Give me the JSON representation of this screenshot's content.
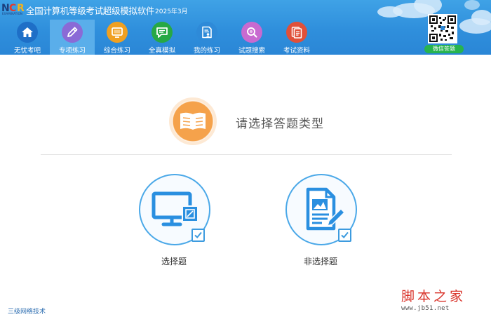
{
  "header": {
    "logo_text": "NCR",
    "logo_subtext": "EXAMINATION",
    "title": "全国计算机等级考试超级模拟软件",
    "year": "2025年3月"
  },
  "nav": {
    "items": [
      {
        "label": "无忧考吧",
        "icon": "home-icon",
        "color": "#1e6fc7",
        "active": false
      },
      {
        "label": "专项练习",
        "icon": "pencil-icon",
        "color": "#8a6ad6",
        "active": true
      },
      {
        "label": "综合练习",
        "icon": "monitor-icon",
        "color": "#f0a020",
        "active": false
      },
      {
        "label": "全真模拟",
        "icon": "chat-icon",
        "color": "#27a845",
        "active": false
      },
      {
        "label": "我的练习",
        "icon": "document-user-icon",
        "color": "#2e8ad8",
        "active": false
      },
      {
        "label": "试题搜索",
        "icon": "search-icon",
        "color": "#c86ad0",
        "active": false
      },
      {
        "label": "考试资料",
        "icon": "documents-icon",
        "color": "#e0503a",
        "active": false
      }
    ]
  },
  "qr": {
    "label": "微信答题"
  },
  "main": {
    "prompt": "请选择答题类型",
    "choices": [
      {
        "label": "选择题",
        "icon": "monitor-icon"
      },
      {
        "label": "非选择题",
        "icon": "document-chart-icon"
      }
    ]
  },
  "footer": {
    "level": "三级网络技术"
  },
  "watermark": {
    "text": "脚本之家",
    "url": "www.jb51.net"
  },
  "colors": {
    "header": "#2f8fdc",
    "accent": "#4aa8e8",
    "orange": "#f29a3d",
    "watermark": "#d9342b"
  }
}
